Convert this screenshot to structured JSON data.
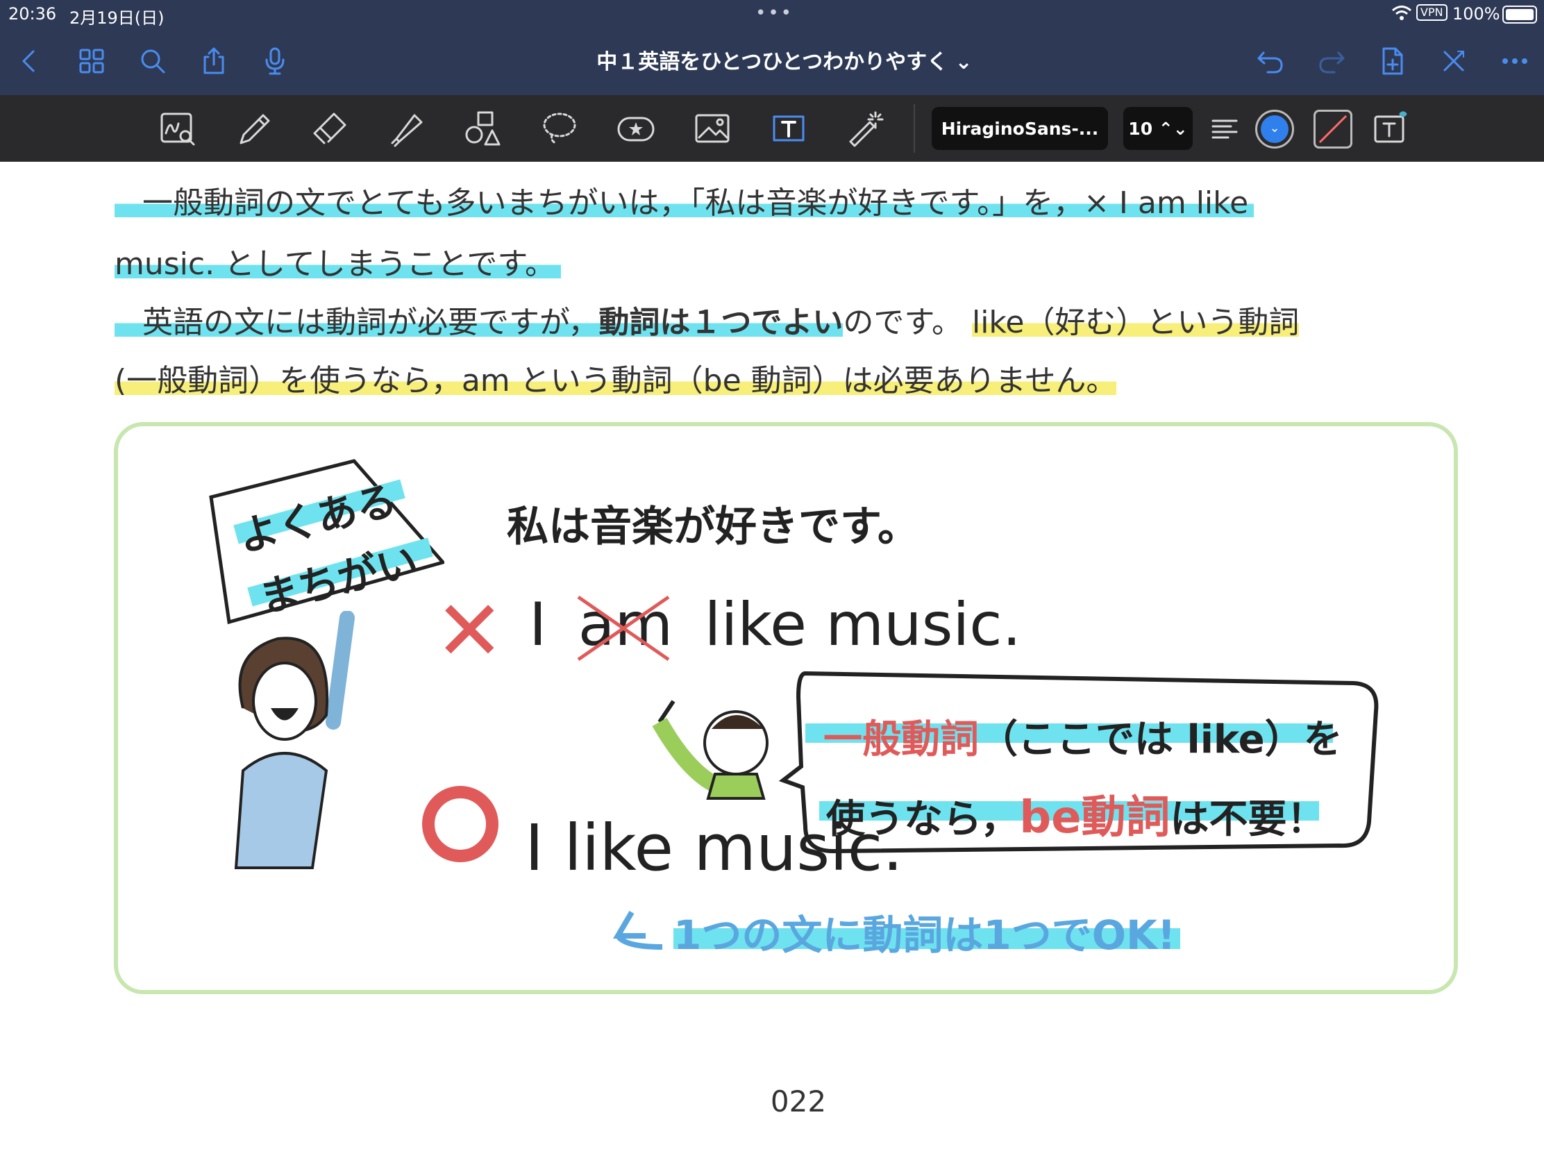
{
  "status_bar": {
    "time": "20:36",
    "date": "2月19日(日)",
    "dots": "•••",
    "vpn": "VPN",
    "battery": "100%"
  },
  "nav": {
    "title": "中１英語をひとつひとつわかりやすく ⌄",
    "icons": [
      "back-icon",
      "thumbnails-icon",
      "search-icon",
      "share-icon",
      "microphone-icon",
      "undo-icon",
      "redo-icon",
      "add-page-icon",
      "close-tools-icon",
      "more-icon"
    ]
  },
  "toolbar": {
    "font": "HiraginoSans-...",
    "size": "10 ⌃⌄",
    "tools": [
      "scribble-icon",
      "pen-icon",
      "eraser-icon",
      "highlighter-icon",
      "shapes-icon",
      "lasso-icon",
      "elements-icon",
      "image-icon",
      "text-tool-icon",
      "laser-pointer-icon"
    ],
    "accent": "#2f80ed"
  },
  "document": {
    "p1_line1": "一般動詞の文でとても多いまちがいは，「私は音楽が好きです。」を，× I am like",
    "p1_line2": "music. としてしまうことです。",
    "p2_line1a": "英語の文には動詞が必要ですが，",
    "p2_line1b": "動詞は１つでよい",
    "p2_line1c": "のです。",
    "p2_line1d": "like（好む）という動詞",
    "p2_line2": "(一般動詞）を使うなら，am という動詞（be 動詞）は必要ありません。",
    "figure": {
      "sign_line1": "よくある",
      "sign_line2": "まちがい",
      "heading": "私は音楽が好きです。",
      "wrong_mark": "✕",
      "wrong_I": "I",
      "wrong_am": "am",
      "wrong_rest": "like music.",
      "bubble_line1a": "一般動詞",
      "bubble_line1b": "（ここでは like）を",
      "bubble_line2a": "使うなら，",
      "bubble_line2b": "be動詞",
      "bubble_line2c": "は不要！",
      "correct_mark": "○",
      "correct_sentence": "I like music.",
      "note": "1つの文に動詞は1つでOK!"
    },
    "page_number": "022"
  }
}
